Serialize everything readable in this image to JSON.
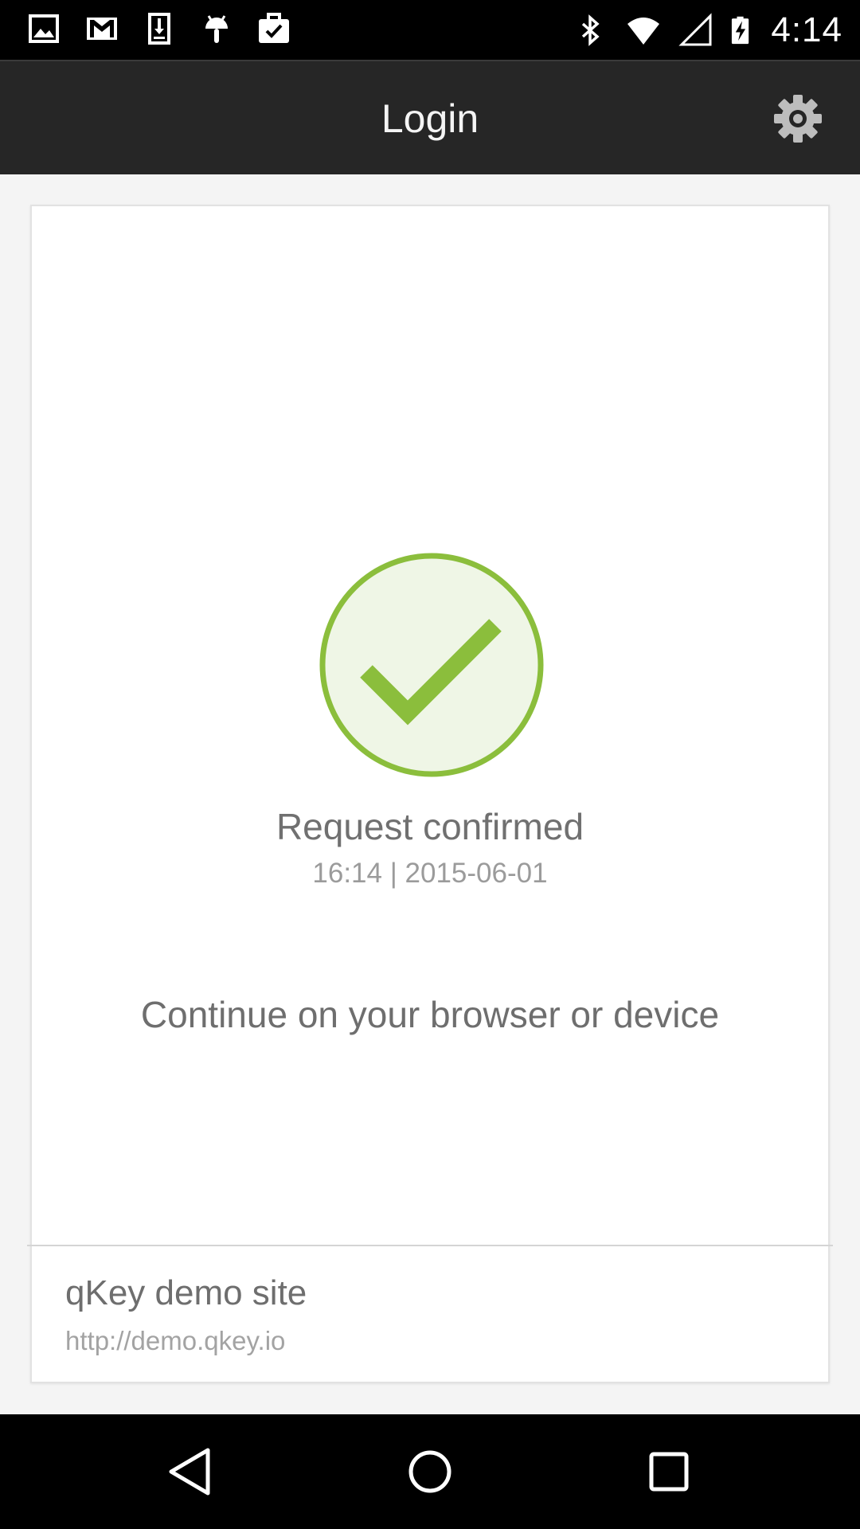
{
  "status_bar": {
    "left_icons": [
      "gallery-icon",
      "gmail-icon",
      "download-icon",
      "android-icon",
      "briefcase-check-icon"
    ],
    "right_icons": [
      "bluetooth-icon",
      "wifi-icon",
      "cell-signal-icon",
      "battery-charging-icon"
    ],
    "time": "4:14"
  },
  "app_bar": {
    "title": "Login",
    "settings_icon": "gear-icon"
  },
  "confirmation": {
    "icon": "check-circle-icon",
    "title": "Request confirmed",
    "timestamp": "16:14 | 2015-06-01",
    "message": "Continue on your browser or device"
  },
  "site": {
    "name": "qKey demo site",
    "url": "http://demo.qkey.io"
  },
  "nav_bar": {
    "buttons": [
      "back-icon",
      "home-icon",
      "recents-icon"
    ]
  },
  "colors": {
    "accent_green": "#8bbe3c",
    "check_bg": "#eff6e6",
    "app_bar_bg": "#262626",
    "status_bar_bg": "#000000"
  }
}
